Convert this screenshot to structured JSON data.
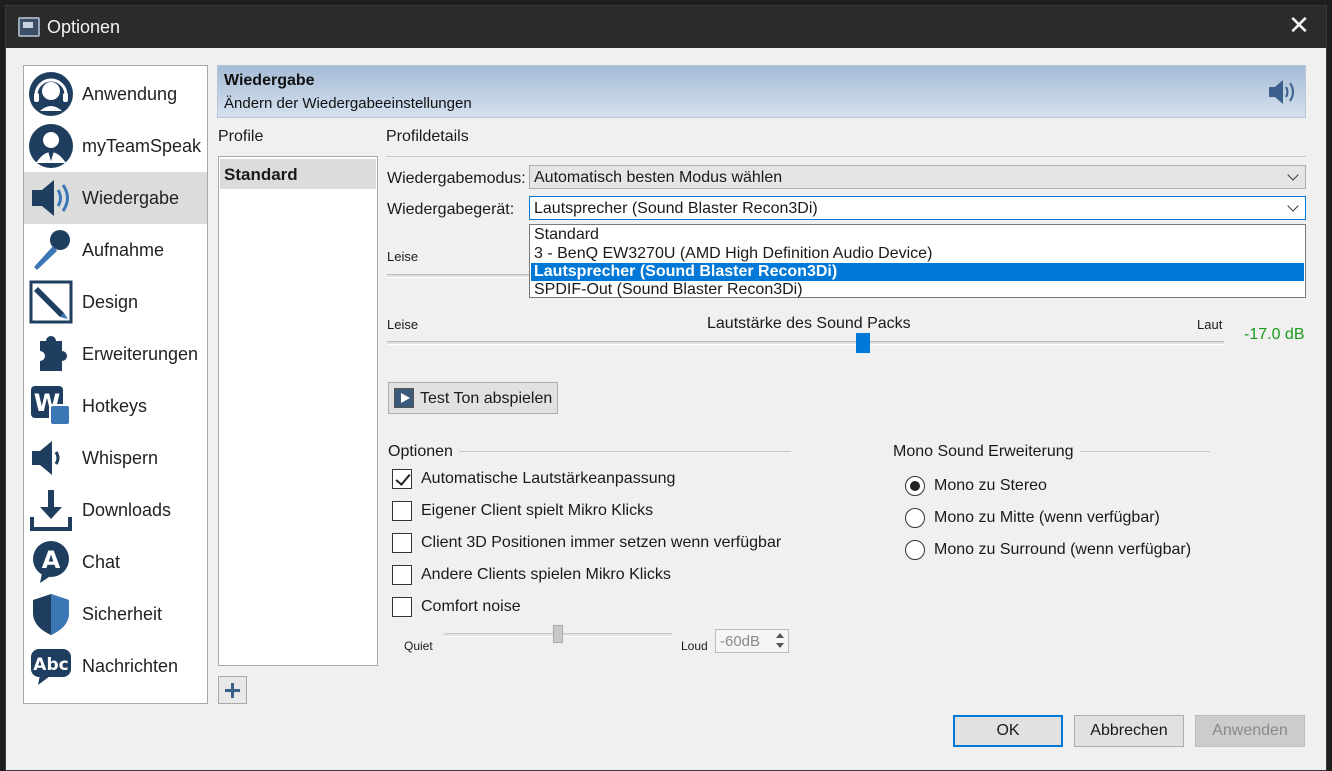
{
  "window": {
    "title": "Optionen",
    "close_glyph": "✕"
  },
  "sidebar": {
    "items": [
      {
        "label": "Anwendung",
        "icon": "headset-avatar-icon"
      },
      {
        "label": "myTeamSpeak",
        "icon": "user-avatar-icon"
      },
      {
        "label": "Wiedergabe",
        "icon": "speaker-icon",
        "active": true
      },
      {
        "label": "Aufnahme",
        "icon": "microphone-icon"
      },
      {
        "label": "Design",
        "icon": "pen-design-icon"
      },
      {
        "label": "Erweiterungen",
        "icon": "puzzle-piece-icon"
      },
      {
        "label": "Hotkeys",
        "icon": "keyboard-w-icon"
      },
      {
        "label": "Whispern",
        "icon": "whisper-speaker-icon"
      },
      {
        "label": "Downloads",
        "icon": "download-icon"
      },
      {
        "label": "Chat",
        "icon": "chat-bubble-icon"
      },
      {
        "label": "Sicherheit",
        "icon": "shield-icon"
      },
      {
        "label": "Nachrichten",
        "icon": "message-abc-icon"
      }
    ]
  },
  "header": {
    "title": "Wiedergabe",
    "subtitle": "Ändern der Wiedergabeeinstellungen",
    "icon": "speaker-icon"
  },
  "profiles": {
    "label": "Profile",
    "items": [
      "Standard"
    ],
    "selected": "Standard"
  },
  "details": {
    "label": "Profildetails",
    "mode_label": "Wiedergabemodus:",
    "mode_value": "Automatisch besten Modus wählen",
    "device_label": "Wiedergabegerät:",
    "device_value": "Lautsprecher (Sound Blaster Recon3Di)",
    "device_options": [
      "Standard",
      "3 - BenQ EW3270U (AMD High Definition Audio Device)",
      "Lautsprecher (Sound Blaster Recon3Di)",
      "SPDIF-Out (Sound Blaster Recon3Di)"
    ],
    "device_selected_index": 2,
    "volume_left_label": "Leise",
    "soundpack_left_label": "Leise",
    "soundpack_title": "Lautstärke des Sound Packs",
    "soundpack_right_label": "Laut",
    "soundpack_db": "-17.0 dB",
    "soundpack_position": 0.57,
    "test_button": "Test Ton abspielen"
  },
  "options": {
    "title": "Optionen",
    "checkboxes": [
      {
        "label": "Automatische Lautstärkeanpassung",
        "checked": true
      },
      {
        "label": "Eigener Client spielt Mikro Klicks",
        "checked": false
      },
      {
        "label": "Client 3D Positionen immer setzen wenn verfügbar",
        "checked": false
      },
      {
        "label": "Andere Clients spielen Mikro Klicks",
        "checked": false
      },
      {
        "label": "Comfort noise",
        "checked": false
      }
    ],
    "noise_left": "Quiet",
    "noise_right": "Loud",
    "noise_value": "-60dB",
    "noise_position": 0.5
  },
  "mono": {
    "title": "Mono Sound Erweiterung",
    "radios": [
      {
        "label": "Mono zu Stereo",
        "checked": true
      },
      {
        "label": "Mono zu Mitte (wenn verfügbar)",
        "checked": false
      },
      {
        "label": "Mono zu Surround (wenn verfügbar)",
        "checked": false
      }
    ]
  },
  "buttons": {
    "ok": "OK",
    "cancel": "Abbrechen",
    "apply": "Anwenden"
  },
  "colors": {
    "accent": "#0078d7",
    "db_green": "#1a9a1a",
    "icon_blue": "#1f3d5e"
  }
}
